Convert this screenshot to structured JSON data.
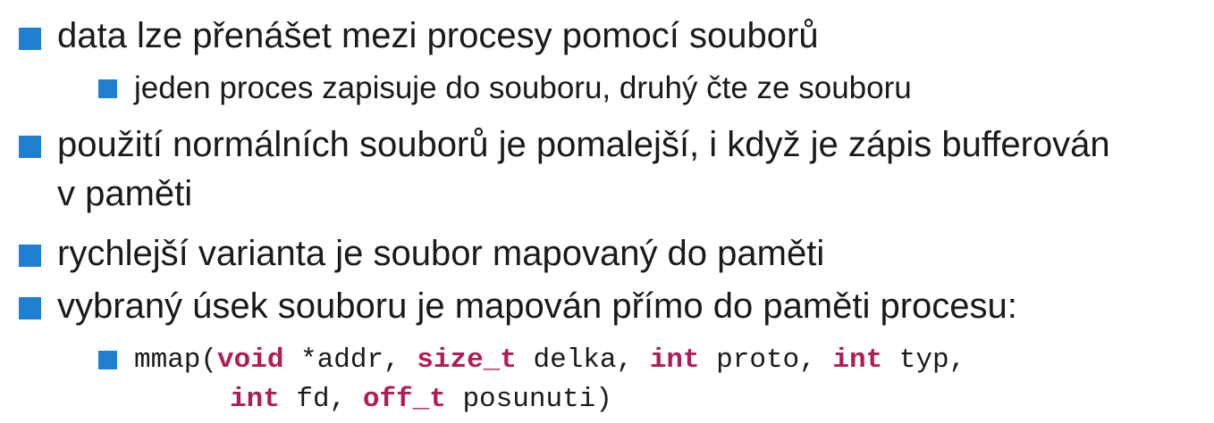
{
  "bullets": [
    {
      "text": "data lze přenášet mezi procesy pomocí souborů"
    },
    {
      "text": "jeden proces zapisuje do souboru, druhý čte ze souboru"
    },
    {
      "text_line1": "použití normálních souborů je pomalejší, i když je zápis bufferován",
      "text_line2": "v paměti"
    },
    {
      "text": "rychlejší varianta je soubor mapovaný do paměti"
    },
    {
      "text": "vybraný úsek souboru je mapován přímo do paměti procesu:"
    }
  ],
  "code": {
    "line1": {
      "fn": "mmap(",
      "t1": "void",
      "a1": " *addr, ",
      "t2": "size_t",
      "a2": " delka, ",
      "t3": "int",
      "a3": " proto, ",
      "t4": "int",
      "a4": " typ,"
    },
    "line2": {
      "t5": "int",
      "a5": " fd, ",
      "t6": "off_t",
      "a6": " posunuti)"
    }
  },
  "colors": {
    "bullet": "#1f7fd0",
    "keyword": "#b01c5a",
    "text": "#1a1a1a"
  }
}
